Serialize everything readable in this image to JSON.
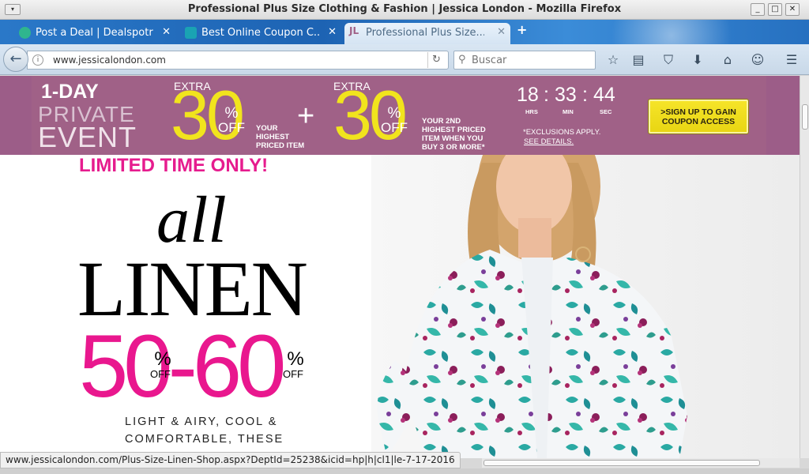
{
  "window": {
    "title": "Professional Plus Size Clothing & Fashion | Jessica London - Mozilla Firefox"
  },
  "tabs": [
    {
      "label": "Post a Deal | Dealspotr",
      "icon": "dealspotr-icon",
      "color": "#2fb58e"
    },
    {
      "label": "Best Online Coupon C...",
      "icon": "coupon-site-icon",
      "color": "#1aa3b3"
    },
    {
      "label": "Professional Plus Size...",
      "icon": "jessica-london-icon",
      "color": "#a06187",
      "active": true
    }
  ],
  "navbar": {
    "url": "www.jessicalondon.com",
    "search_placeholder": "Buscar"
  },
  "promo": {
    "headline": "1-DAY",
    "private": "PRIVATE",
    "event": "EVENT",
    "offer1": {
      "extra": "EXTRA",
      "value": "30",
      "pct": "%",
      "off": "OFF",
      "desc": [
        "YOUR",
        "HIGHEST",
        "PRICED ITEM"
      ]
    },
    "plus": "+",
    "offer2": {
      "extra": "EXTRA",
      "value": "30",
      "pct": "%",
      "off": "OFF",
      "desc": [
        "YOUR 2ND",
        "HIGHEST PRICED",
        "ITEM WHEN YOU",
        "BUY 3 OR MORE*"
      ]
    },
    "timer": {
      "hours": "18",
      "minutes": "33",
      "seconds": "44",
      "sep": ":",
      "hrs_label": "HRS",
      "min_label": "MIN",
      "sec_label": "SEC"
    },
    "exclusions": "*EXCLUSIONS APPLY.",
    "see_details": "SEE DETAILS.",
    "signup_line1": ">SIGN UP TO GAIN",
    "signup_line2": "COUPON ACCESS"
  },
  "hero": {
    "limited": "LIMITED TIME ONLY!",
    "all": "all",
    "linen": "LINEN",
    "discount": "50-60",
    "pct": "%",
    "off": "OFF",
    "tagline1": "LIGHT & AIRY, COOL &",
    "tagline2": "COMFORTABLE, THESE"
  },
  "status_url": "www.jessicalondon.com/Plus-Size-Linen-Shop.aspx?DeptId=25238&icid=hp|h|cl1|le-7-17-2016",
  "colors": {
    "promo_bg": "#a06187",
    "promo_yellow": "#f1e41d",
    "hero_pink": "#e9178e",
    "limited_pink": "#e61c8e"
  }
}
